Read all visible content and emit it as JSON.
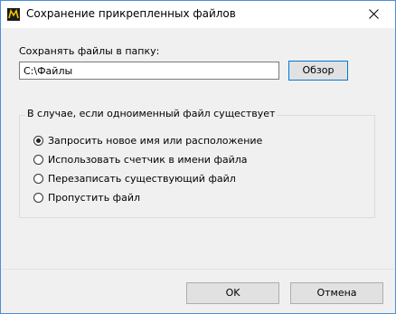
{
  "window": {
    "title": "Сохранение прикрепленных файлов"
  },
  "folder": {
    "label": "Сохранять файлы в папку:",
    "value": "C:\\Файлы",
    "browse_label": "Обзор"
  },
  "conflict_group": {
    "title": "В случае, если одноименный файл существует",
    "options": [
      {
        "label": "Запросить новое имя или расположение",
        "checked": true
      },
      {
        "label": "Использовать счетчик в имени файла",
        "checked": false
      },
      {
        "label": "Перезаписать существующий файл",
        "checked": false
      },
      {
        "label": "Пропустить файл",
        "checked": false
      }
    ]
  },
  "buttons": {
    "ok_label": "OK",
    "cancel_label": "Отмена"
  },
  "icons": {
    "app": "app-icon",
    "close": "close-icon"
  }
}
